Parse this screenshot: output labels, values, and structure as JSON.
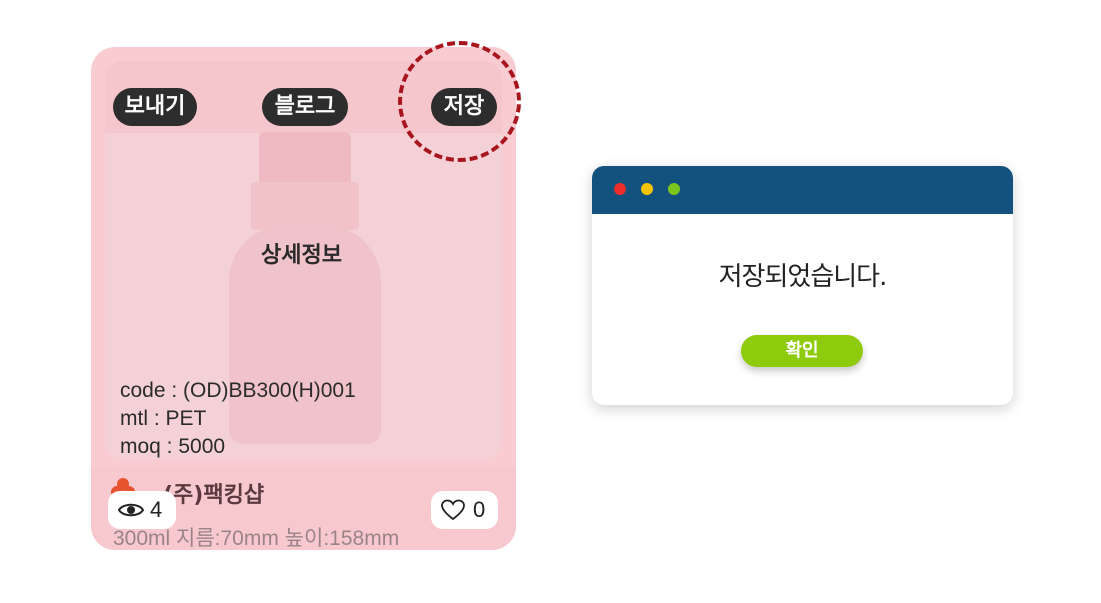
{
  "card": {
    "buttons": {
      "send": "보내기",
      "blog": "블로그",
      "save": "저장"
    },
    "detail_label": "상세정보",
    "specs": {
      "code": "code : (OD)BB300(H)001",
      "mtl": "mtl : PET",
      "moq": "moq : 5000"
    },
    "company_name": "(주)팩킹샵",
    "views": "4",
    "likes": "0",
    "size_text": "300ml 지름:70mm 높이:158mm",
    "icons": [
      "eye-icon",
      "heart-icon",
      "company-logo-icon"
    ],
    "colors": {
      "highlight": "#a8151d",
      "card": "#f8ccd0"
    }
  },
  "dialog": {
    "message": "저장되었습니다.",
    "ok_label": "확인",
    "colors": {
      "titlebar": "#13527e",
      "button": "#8fcb0d"
    }
  }
}
